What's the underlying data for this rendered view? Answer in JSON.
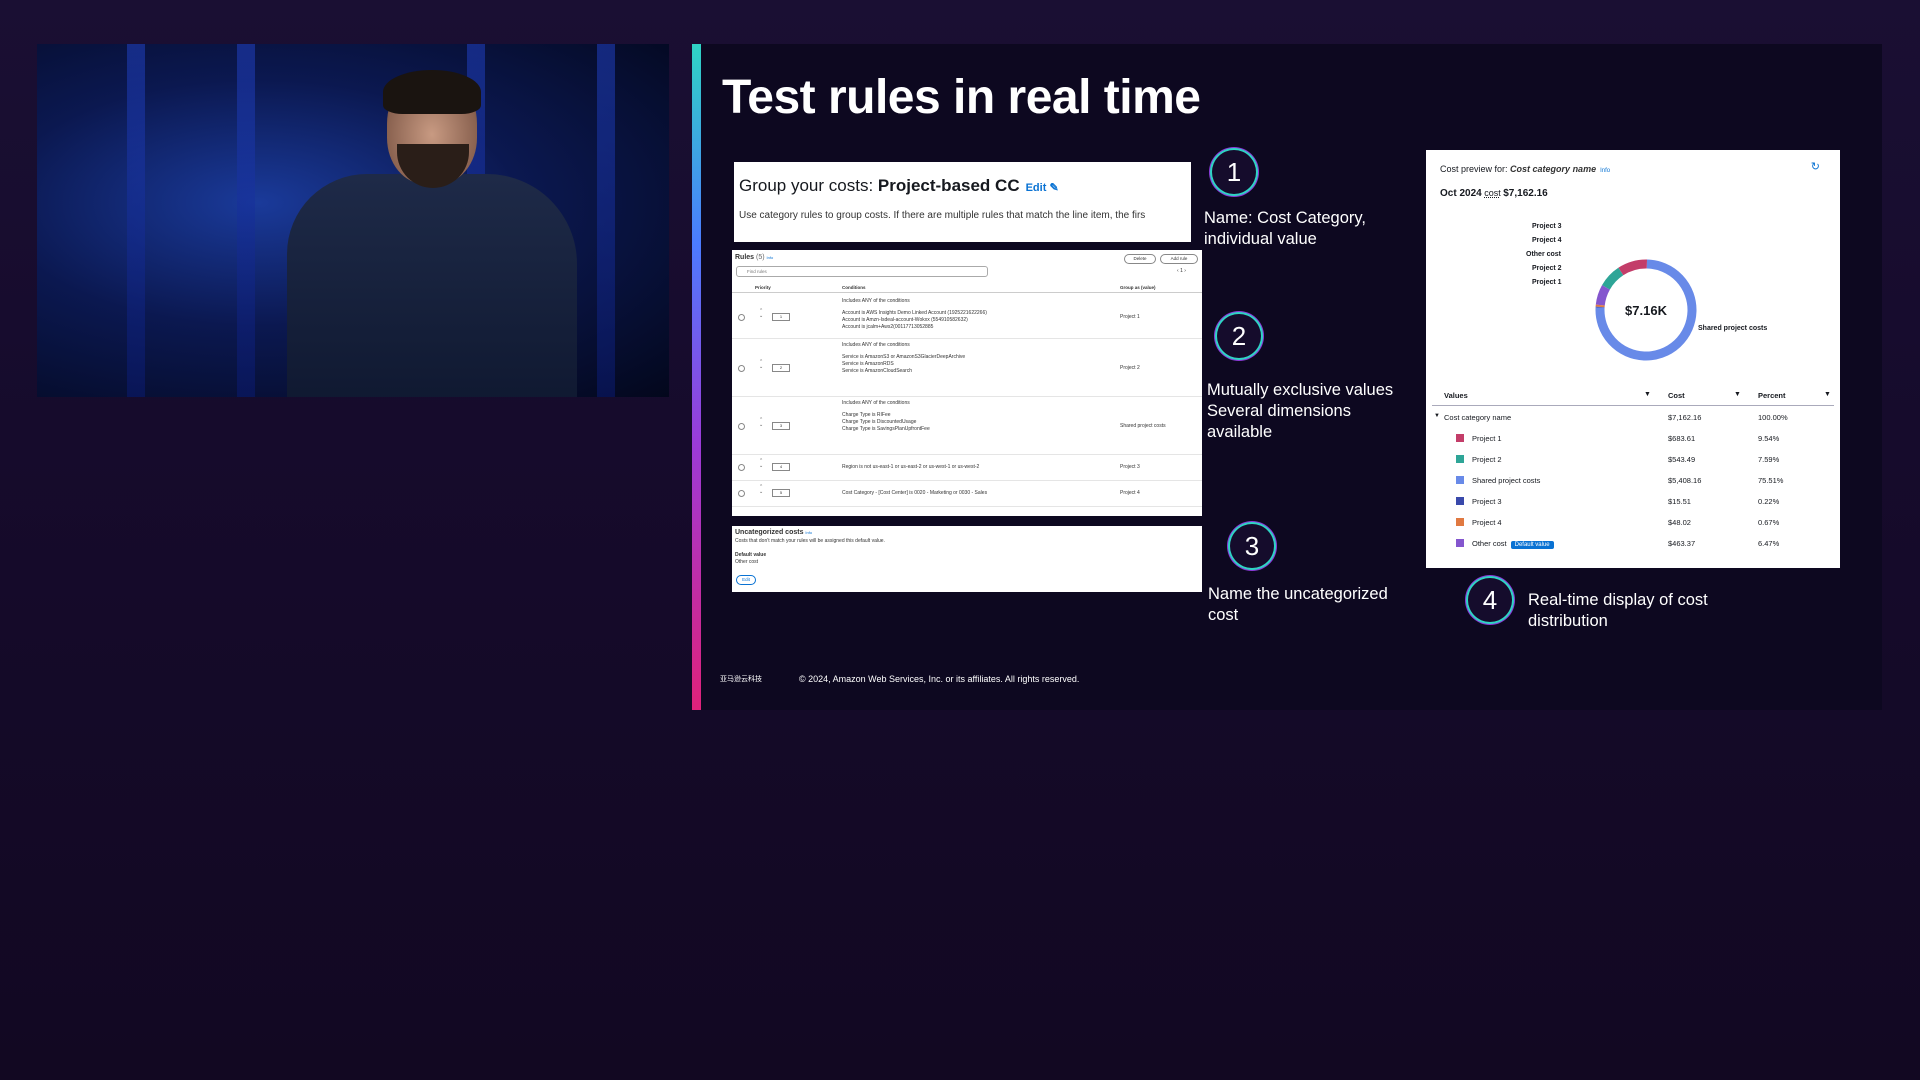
{
  "slide": {
    "title": "Test rules in real time",
    "footer_logo": "亚马逊云科技",
    "copyright": "© 2024, Amazon Web Services, Inc. or its affiliates. All rights reserved."
  },
  "card_group": {
    "prefix": "Group your costs: ",
    "name": "Project-based CC",
    "edit": "Edit",
    "description": "Use category rules to group costs. If there are multiple rules that match the line item, the firs"
  },
  "rules": {
    "title": "Rules",
    "count": "(5)",
    "info": "Info",
    "delete": "Delete",
    "add": "Add rule",
    "search_placeholder": "Find rules",
    "pages": "1",
    "col_priority": "Priority",
    "col_conditions": "Conditions",
    "col_group": "Group as (value)",
    "rows": [
      {
        "priority": "1",
        "lines": [
          "Includes ANY of the conditions",
          "Account is AWS Insights Demo Linked Account (1925221622266)",
          "Account is Amzn-Isdeal-account-Wokxx (554910582632)",
          "Account is jcalm+Aws2(00117713052885"
        ],
        "group": "Project 1"
      },
      {
        "priority": "2",
        "lines": [
          "Includes ANY of the conditions",
          "Service is AmazonS3 or AmazonS3GlacierDeepArchive",
          "Service is AmazonRDS",
          "Service is AmazonCloudSearch"
        ],
        "group": "Project 2"
      },
      {
        "priority": "3",
        "lines": [
          "Includes ANY of the conditions",
          "Charge Type is RIFee",
          "Charge Type is DiscountedUsage",
          "Charge Type is SavingsPlanUpfrontFee"
        ],
        "group": "Shared project costs"
      },
      {
        "priority": "4",
        "lines": [
          "Region is not us-east-1 or us-east-2 or us-west-1 or us-west-2"
        ],
        "group": "Project 3"
      },
      {
        "priority": "5",
        "lines": [
          "Cost Category - [Cost Center] is 0020 - Marketing or 0030 - Sales"
        ],
        "group": "Project 4"
      }
    ]
  },
  "uncategorized": {
    "title": "Uncategorized costs",
    "info": "Info",
    "desc": "Costs that don't match your rules will be assigned this default value.",
    "default_label": "Default value",
    "default_value": "Other cost",
    "edit": "Edit"
  },
  "steps": [
    {
      "num": "1",
      "text1": "Name: Cost Category,",
      "text2": "individual value",
      "text3": ""
    },
    {
      "num": "2",
      "text1": "Mutually exclusive values",
      "text2": "Several dimensions",
      "text3": "available"
    },
    {
      "num": "3",
      "text1": "Name the uncategorized",
      "text2": "cost",
      "text3": ""
    },
    {
      "num": "4",
      "text1": "Real-time display of cost",
      "text2": "distribution",
      "text3": ""
    }
  ],
  "preview": {
    "label": "Cost preview for:",
    "name": "Cost category name",
    "info": "Info",
    "period": "Oct 2024",
    "cost_word": "cost",
    "total": "$7,162.16",
    "center": "$7.16K",
    "col_values": "Values",
    "col_cost": "Cost",
    "col_percent": "Percent",
    "root": {
      "name": "Cost category name",
      "cost": "$7,162.16",
      "percent": "100.00%"
    },
    "default_badge": "Default value"
  },
  "chart_data": {
    "type": "pie",
    "center_label": "$7.16K",
    "categories": [
      "Project 1",
      "Project 2",
      "Shared project costs",
      "Project 3",
      "Project 4",
      "Other cost"
    ],
    "values": [
      683.61,
      543.49,
      5408.16,
      15.51,
      48.02,
      463.37
    ],
    "costs": [
      "$683.61",
      "$543.49",
      "$5,408.16",
      "$15.51",
      "$48.02",
      "$463.37"
    ],
    "percents": [
      "9.54%",
      "7.59%",
      "75.51%",
      "0.22%",
      "0.67%",
      "6.47%"
    ],
    "colors": [
      "#c33d69",
      "#2ea597",
      "#688ae8",
      "#3949ab",
      "#e07941",
      "#8456ce"
    ]
  }
}
